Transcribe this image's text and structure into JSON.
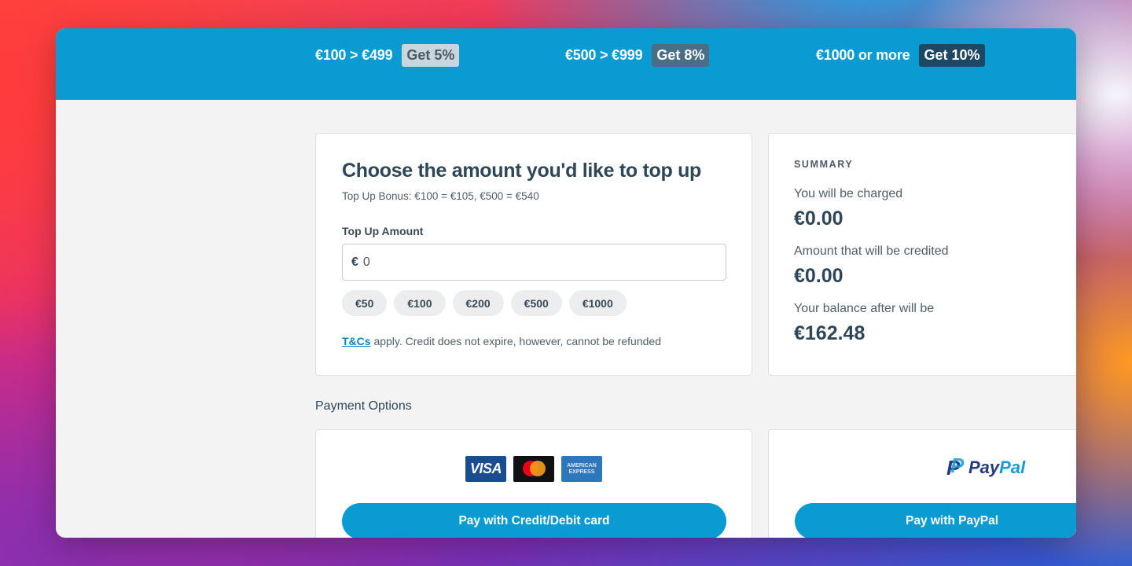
{
  "banner": {
    "tiers": [
      {
        "range": "€100 > €499",
        "badge": "Get 5%"
      },
      {
        "range": "€500 > €999",
        "badge": "Get 8%"
      },
      {
        "range": "€1000 or more",
        "badge": "Get 10%"
      }
    ],
    "color": "#0a9bd2"
  },
  "topup": {
    "title": "Choose the amount you'd like to top up",
    "bonus_text": "Top Up Bonus: €100 = €105, €500 = €540",
    "amount_label": "Top Up Amount",
    "currency_symbol": "€",
    "amount_value": "0",
    "quick_amounts": [
      "€50",
      "€100",
      "€200",
      "€500",
      "€1000"
    ],
    "terms_link": "T&Cs",
    "terms_text": " apply. Credit does not expire, however, cannot be refunded"
  },
  "summary": {
    "heading": "SUMMARY",
    "charged_label": "You will be charged",
    "charged_value": "€0.00",
    "credited_label": "Amount that will be credited",
    "credited_value": "€0.00",
    "balance_label": "Your balance after will be",
    "balance_value": "€162.48"
  },
  "payment": {
    "section_title": "Payment Options",
    "card_logos": {
      "visa": "VISA",
      "amex": "AMERICAN EXPRESS"
    },
    "card_button": "Pay with Credit/Debit card",
    "paypal_logo_pay": "Pay",
    "paypal_logo_pal": "Pal",
    "paypal_button": "Pay with PayPal"
  }
}
